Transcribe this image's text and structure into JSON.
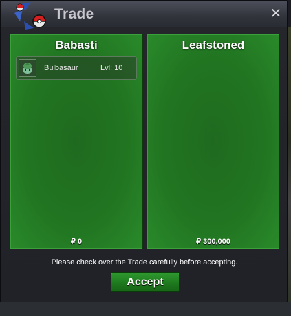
{
  "window": {
    "title": "Trade",
    "close_label": "✕"
  },
  "left_panel": {
    "player": "Babasti",
    "money": "₽ 0",
    "items": [
      {
        "name": "Bulbasaur",
        "level": "Lvl: 10",
        "icon": "bulbasaur-icon"
      }
    ]
  },
  "right_panel": {
    "player": "Leafstoned",
    "money": "₽ 300,000"
  },
  "footer": {
    "notice": "Please check over the Trade carefully before accepting.",
    "accept_label": "Accept"
  },
  "colors": {
    "panel_green": "#217521",
    "accept_green": "#1e7a1e",
    "title_text": "#c7c7cd"
  }
}
